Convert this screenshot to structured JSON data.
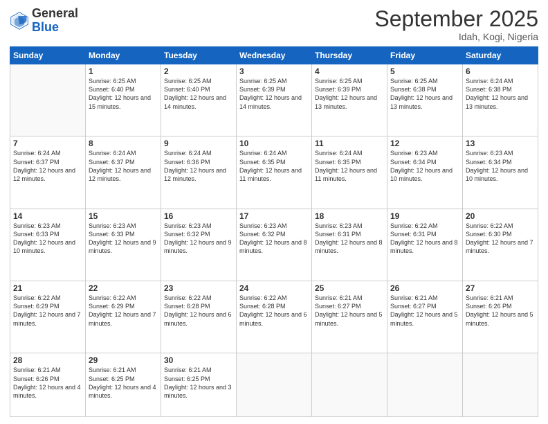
{
  "logo": {
    "general": "General",
    "blue": "Blue"
  },
  "header": {
    "month": "September 2025",
    "location": "Idah, Kogi, Nigeria"
  },
  "weekdays": [
    "Sunday",
    "Monday",
    "Tuesday",
    "Wednesday",
    "Thursday",
    "Friday",
    "Saturday"
  ],
  "weeks": [
    [
      {
        "day": "",
        "info": ""
      },
      {
        "day": "1",
        "info": "Sunrise: 6:25 AM\nSunset: 6:40 PM\nDaylight: 12 hours\nand 15 minutes."
      },
      {
        "day": "2",
        "info": "Sunrise: 6:25 AM\nSunset: 6:40 PM\nDaylight: 12 hours\nand 14 minutes."
      },
      {
        "day": "3",
        "info": "Sunrise: 6:25 AM\nSunset: 6:39 PM\nDaylight: 12 hours\nand 14 minutes."
      },
      {
        "day": "4",
        "info": "Sunrise: 6:25 AM\nSunset: 6:39 PM\nDaylight: 12 hours\nand 13 minutes."
      },
      {
        "day": "5",
        "info": "Sunrise: 6:25 AM\nSunset: 6:38 PM\nDaylight: 12 hours\nand 13 minutes."
      },
      {
        "day": "6",
        "info": "Sunrise: 6:24 AM\nSunset: 6:38 PM\nDaylight: 12 hours\nand 13 minutes."
      }
    ],
    [
      {
        "day": "7",
        "info": "Sunrise: 6:24 AM\nSunset: 6:37 PM\nDaylight: 12 hours\nand 12 minutes."
      },
      {
        "day": "8",
        "info": "Sunrise: 6:24 AM\nSunset: 6:37 PM\nDaylight: 12 hours\nand 12 minutes."
      },
      {
        "day": "9",
        "info": "Sunrise: 6:24 AM\nSunset: 6:36 PM\nDaylight: 12 hours\nand 12 minutes."
      },
      {
        "day": "10",
        "info": "Sunrise: 6:24 AM\nSunset: 6:35 PM\nDaylight: 12 hours\nand 11 minutes."
      },
      {
        "day": "11",
        "info": "Sunrise: 6:24 AM\nSunset: 6:35 PM\nDaylight: 12 hours\nand 11 minutes."
      },
      {
        "day": "12",
        "info": "Sunrise: 6:23 AM\nSunset: 6:34 PM\nDaylight: 12 hours\nand 10 minutes."
      },
      {
        "day": "13",
        "info": "Sunrise: 6:23 AM\nSunset: 6:34 PM\nDaylight: 12 hours\nand 10 minutes."
      }
    ],
    [
      {
        "day": "14",
        "info": "Sunrise: 6:23 AM\nSunset: 6:33 PM\nDaylight: 12 hours\nand 10 minutes."
      },
      {
        "day": "15",
        "info": "Sunrise: 6:23 AM\nSunset: 6:33 PM\nDaylight: 12 hours\nand 9 minutes."
      },
      {
        "day": "16",
        "info": "Sunrise: 6:23 AM\nSunset: 6:32 PM\nDaylight: 12 hours\nand 9 minutes."
      },
      {
        "day": "17",
        "info": "Sunrise: 6:23 AM\nSunset: 6:32 PM\nDaylight: 12 hours\nand 8 minutes."
      },
      {
        "day": "18",
        "info": "Sunrise: 6:23 AM\nSunset: 6:31 PM\nDaylight: 12 hours\nand 8 minutes."
      },
      {
        "day": "19",
        "info": "Sunrise: 6:22 AM\nSunset: 6:31 PM\nDaylight: 12 hours\nand 8 minutes."
      },
      {
        "day": "20",
        "info": "Sunrise: 6:22 AM\nSunset: 6:30 PM\nDaylight: 12 hours\nand 7 minutes."
      }
    ],
    [
      {
        "day": "21",
        "info": "Sunrise: 6:22 AM\nSunset: 6:29 PM\nDaylight: 12 hours\nand 7 minutes."
      },
      {
        "day": "22",
        "info": "Sunrise: 6:22 AM\nSunset: 6:29 PM\nDaylight: 12 hours\nand 7 minutes."
      },
      {
        "day": "23",
        "info": "Sunrise: 6:22 AM\nSunset: 6:28 PM\nDaylight: 12 hours\nand 6 minutes."
      },
      {
        "day": "24",
        "info": "Sunrise: 6:22 AM\nSunset: 6:28 PM\nDaylight: 12 hours\nand 6 minutes."
      },
      {
        "day": "25",
        "info": "Sunrise: 6:21 AM\nSunset: 6:27 PM\nDaylight: 12 hours\nand 5 minutes."
      },
      {
        "day": "26",
        "info": "Sunrise: 6:21 AM\nSunset: 6:27 PM\nDaylight: 12 hours\nand 5 minutes."
      },
      {
        "day": "27",
        "info": "Sunrise: 6:21 AM\nSunset: 6:26 PM\nDaylight: 12 hours\nand 5 minutes."
      }
    ],
    [
      {
        "day": "28",
        "info": "Sunrise: 6:21 AM\nSunset: 6:26 PM\nDaylight: 12 hours\nand 4 minutes."
      },
      {
        "day": "29",
        "info": "Sunrise: 6:21 AM\nSunset: 6:25 PM\nDaylight: 12 hours\nand 4 minutes."
      },
      {
        "day": "30",
        "info": "Sunrise: 6:21 AM\nSunset: 6:25 PM\nDaylight: 12 hours\nand 3 minutes."
      },
      {
        "day": "",
        "info": ""
      },
      {
        "day": "",
        "info": ""
      },
      {
        "day": "",
        "info": ""
      },
      {
        "day": "",
        "info": ""
      }
    ]
  ]
}
